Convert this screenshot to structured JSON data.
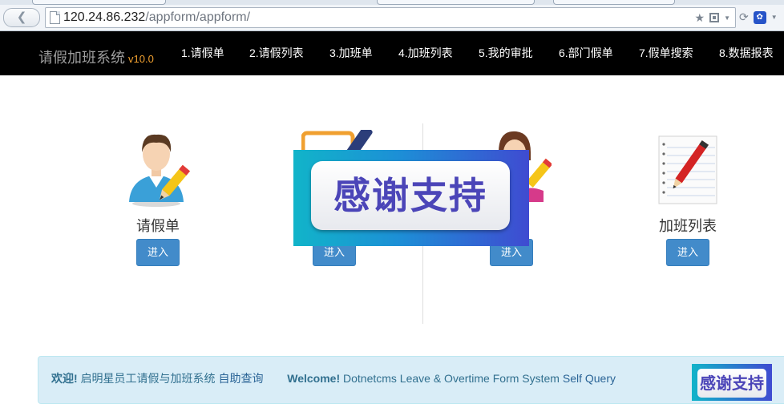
{
  "browser": {
    "url_host": "120.24.86.232",
    "url_path": "/appform/appform/",
    "icons": [
      "back-arrow-icon",
      "page-icon",
      "star-icon",
      "qr-code-icon",
      "reload-icon",
      "paw-icon"
    ]
  },
  "navbar": {
    "brand": "请假加班系统",
    "version": "v10.0",
    "items": [
      "1.请假单",
      "2.请假列表",
      "3.加班单",
      "4.加班列表",
      "5.我的审批",
      "6.部门假单",
      "7.假单搜索",
      "8.数据报表"
    ]
  },
  "cards": [
    {
      "label": "请假单",
      "button": "进入",
      "icon": "man-pencil-icon"
    },
    {
      "label": "",
      "button": "进入",
      "icon": "clipboard-icon"
    },
    {
      "label": "",
      "button": "进入",
      "icon": "woman-pencil-icon"
    },
    {
      "label": "加班列表",
      "button": "进入",
      "icon": "notepad-pencil-icon"
    }
  ],
  "overlay_ad": {
    "text": "感谢支持"
  },
  "footer": {
    "welcome_cn": "欢迎!",
    "desc_cn": "启明星员工请假与加班系统",
    "link_cn": "自助查询",
    "welcome_en": "Welcome!",
    "desc_en": "Dotnetcms Leave & Overtime Form System",
    "link_en": "Self Query"
  },
  "mini_ad": {
    "text": "感谢支持"
  },
  "colors": {
    "navbar_bg": "#000000",
    "brand_version": "#f0a030",
    "button_primary": "#428bca",
    "footer_bg": "#d9edf7",
    "footer_text": "#31708f",
    "ad_text": "#4b45b8"
  }
}
